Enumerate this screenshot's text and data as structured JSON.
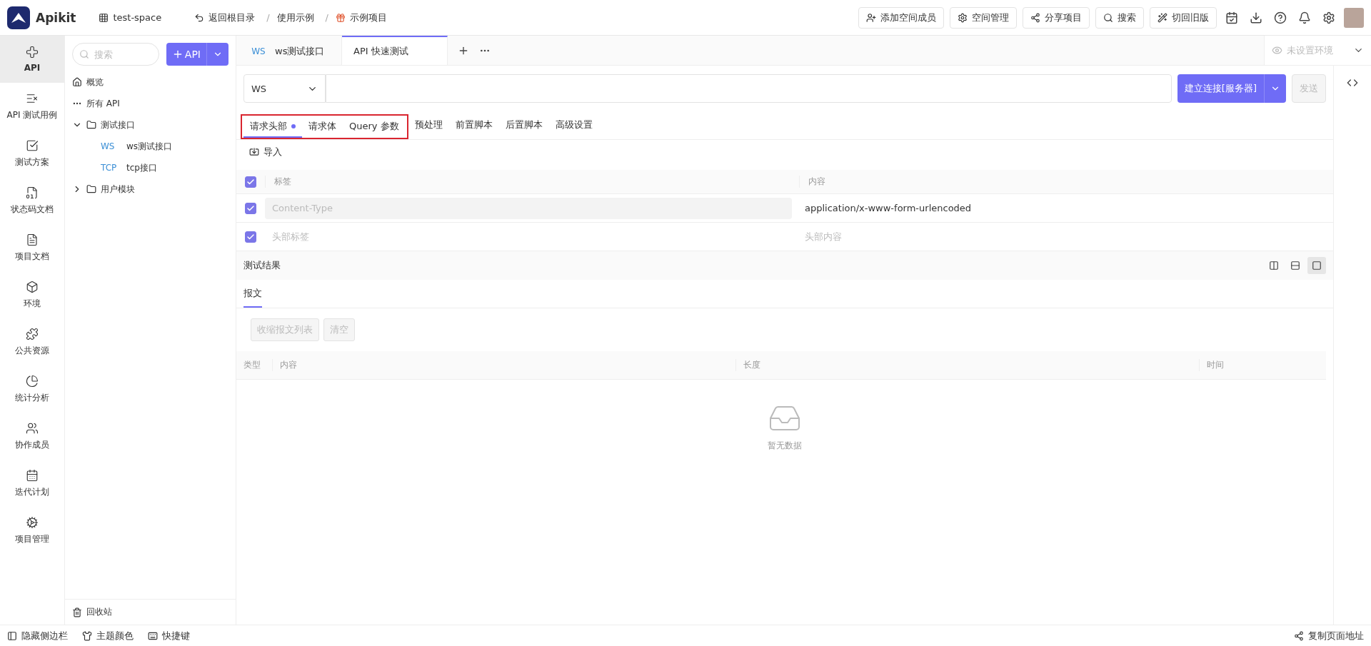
{
  "header": {
    "logo": "Apikit",
    "space": "test-space",
    "back": "返回根目录",
    "separator": "/",
    "breadcrumbs": [
      {
        "label": "使用示例",
        "kind": "folder"
      },
      {
        "label": "示例项目",
        "kind": "project"
      }
    ],
    "actions": [
      {
        "label": "添加空间成员",
        "kind": "member"
      },
      {
        "label": "空间管理",
        "kind": "settings"
      },
      {
        "label": "分享项目",
        "kind": "share"
      },
      {
        "label": "搜索",
        "kind": "search"
      },
      {
        "label": "切回旧版",
        "kind": "wand"
      }
    ]
  },
  "nav": [
    {
      "label": "API",
      "selected": true
    },
    {
      "label": "API 测试用例",
      "selected": false
    },
    {
      "label": "测试方案",
      "selected": false
    },
    {
      "label": "状态码文档",
      "selected": false
    },
    {
      "label": "项目文档",
      "selected": false
    },
    {
      "label": "环境",
      "selected": false
    },
    {
      "label": "公共资源",
      "selected": false
    },
    {
      "label": "统计分析",
      "selected": false
    },
    {
      "label": "协作成员",
      "selected": false
    },
    {
      "label": "迭代计划",
      "selected": false
    },
    {
      "label": "项目管理",
      "selected": false
    }
  ],
  "tree": {
    "search_placeholder": "搜索",
    "add_label": "API",
    "items": [
      {
        "label": "概览",
        "kind": "home"
      },
      {
        "label": "所有 API",
        "kind": "all"
      },
      {
        "label": "测试接口",
        "kind": "folder",
        "expanded": true,
        "children": [
          {
            "method": "WS",
            "label": "ws测试接口"
          },
          {
            "method": "TCP",
            "label": "tcp接口"
          }
        ]
      },
      {
        "label": "用户模块",
        "kind": "folder",
        "expanded": false
      }
    ],
    "recycle": "回收站"
  },
  "open_tabs": [
    {
      "method": "WS",
      "label": "ws测试接口",
      "selected": false
    },
    {
      "label": "API 快速测试",
      "selected": true
    }
  ],
  "env": {
    "placeholder": "未设置环境"
  },
  "request": {
    "protocol": "WS",
    "connect": "建立连接[服务器]",
    "send": "发送"
  },
  "request_tabs": [
    {
      "label": "请求头部",
      "selected": true,
      "dot": true,
      "highlighted": true
    },
    {
      "label": "请求体",
      "selected": false,
      "dot": false,
      "highlighted": true
    },
    {
      "label": "Query 参数",
      "selected": false,
      "dot": false,
      "highlighted": true
    },
    {
      "label": "预处理",
      "selected": false,
      "dot": false,
      "highlighted": false
    },
    {
      "label": "前置脚本",
      "selected": false,
      "dot": false,
      "highlighted": false
    },
    {
      "label": "后置脚本",
      "selected": false,
      "dot": false,
      "highlighted": false
    },
    {
      "label": "高级设置",
      "selected": false,
      "dot": false,
      "highlighted": false
    }
  ],
  "import": "导入",
  "headers": {
    "columns": [
      "标签",
      "内容"
    ],
    "all_checked": true,
    "rows": [
      {
        "checked": true,
        "name": "Content-Type",
        "name_disabled": true,
        "value": "application/x-www-form-urlencoded"
      },
      {
        "checked": true,
        "name_placeholder": "头部标签",
        "value_placeholder": "头部内容"
      }
    ]
  },
  "result": {
    "title": "测试结果",
    "layout_modes": [
      {
        "kind": "columns",
        "selected": false
      },
      {
        "kind": "rows",
        "selected": false
      },
      {
        "kind": "single",
        "selected": true
      }
    ],
    "tabs": [
      {
        "label": "报文",
        "selected": true
      }
    ],
    "buttons": [
      {
        "label": "收缩报文列表",
        "disabled": true
      },
      {
        "label": "清空",
        "disabled": true
      }
    ],
    "columns": [
      "类型",
      "内容",
      "长度",
      "时间"
    ],
    "empty": "暂无数据"
  },
  "footer": {
    "items": [
      {
        "label": "隐藏侧边栏",
        "kind": "sidebar"
      },
      {
        "label": "主题颜色",
        "kind": "shirt"
      },
      {
        "label": "快捷键",
        "kind": "keyboard"
      }
    ],
    "copy": "复制页面地址"
  }
}
